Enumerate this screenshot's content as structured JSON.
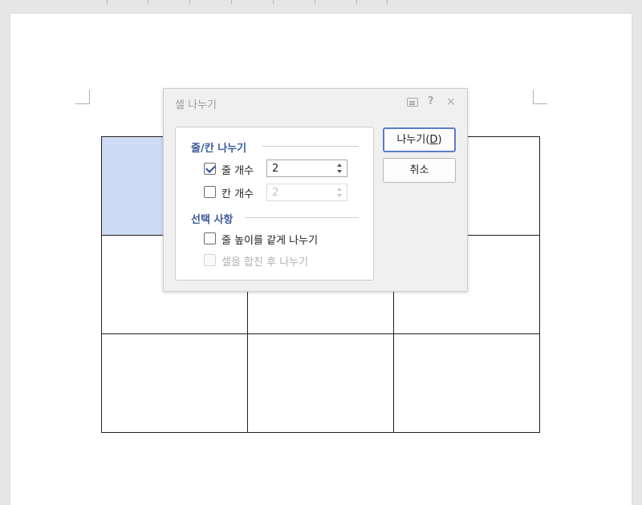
{
  "dialog": {
    "title": "셀 나누기",
    "icons": {
      "comment": "comment-icon",
      "help": "?",
      "close": "×"
    },
    "section_split": {
      "title": "줄/칸 나누기",
      "rows": {
        "label": "줄 개수",
        "checked": true,
        "value": "2"
      },
      "cols": {
        "label": "칸 개수",
        "checked": false,
        "value": "2"
      }
    },
    "section_options": {
      "title": "선택 사항",
      "equal_height": {
        "label": "줄 높이를 같게 나누기",
        "checked": false
      },
      "merge_then_split": {
        "label": "셀을 합친 후 나누기",
        "checked": false,
        "disabled": true
      }
    },
    "buttons": {
      "split_label": "나누기(",
      "split_accel": "D",
      "split_close": ")",
      "cancel_label": "취소"
    }
  },
  "colors": {
    "selected_cell": "#cfdaf4",
    "section_title": "#3a5a9a",
    "primary_button_border": "#5b7ec4"
  }
}
